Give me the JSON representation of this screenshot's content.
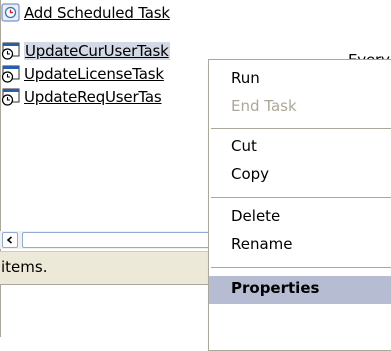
{
  "tasks": [
    {
      "label": "Add Scheduled Task",
      "icon": "add-task-icon"
    },
    {
      "label": "UpdateCurUserTask",
      "icon": "scheduled-task-icon",
      "selected": true
    },
    {
      "label": "UpdateLicenseTask",
      "icon": "scheduled-task-icon"
    },
    {
      "label": "UpdateReqUserTas",
      "icon": "scheduled-task-icon"
    }
  ],
  "detail_text": "Everv",
  "status_text": "items.",
  "menu": {
    "items": [
      {
        "label": "Run",
        "enabled": true
      },
      {
        "label": "End Task",
        "enabled": false
      },
      {
        "separator": true
      },
      {
        "label": "Cut",
        "enabled": true
      },
      {
        "label": "Copy",
        "enabled": true
      },
      {
        "separator": true
      },
      {
        "label": "Delete",
        "enabled": true
      },
      {
        "label": "Rename",
        "enabled": true
      },
      {
        "separator": true
      },
      {
        "label": "Properties",
        "enabled": true,
        "highlighted": true
      }
    ]
  },
  "colors": {
    "menu_highlight": "#b6bdd2",
    "selection": "#d3dae6",
    "disabled_text": "#aca899",
    "statusbar": "#ece9d8"
  }
}
